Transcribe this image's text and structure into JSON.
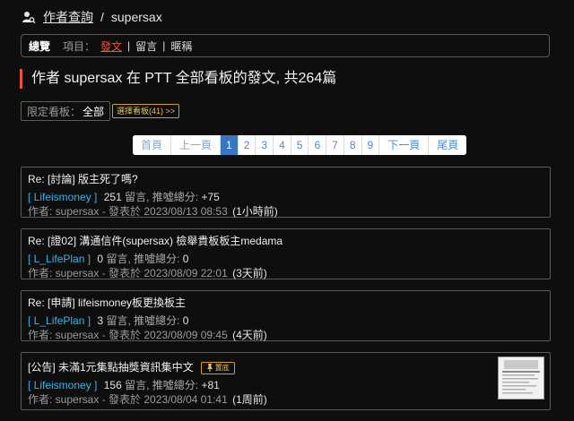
{
  "breadcrumb": {
    "link": "作者查詢",
    "separator": "/",
    "author": "supersax"
  },
  "nav": {
    "overview": "總覽",
    "items_label": "項目：",
    "tabs": [
      {
        "label": "發文",
        "active": true
      },
      {
        "label": "留言",
        "active": false
      },
      {
        "label": "暱稱",
        "active": false
      }
    ],
    "separator": "|"
  },
  "heading": "作者 supersax 在 PTT 全部看板的發文, 共264篇",
  "filter": {
    "label": "限定看板：",
    "value": "全部",
    "select_button": "選擇看板(41) >>"
  },
  "pagination": {
    "first": "首頁",
    "prev": "上一頁",
    "pages": [
      "1",
      "2",
      "3",
      "4",
      "5",
      "6",
      "7",
      "8",
      "9"
    ],
    "current": "1",
    "next": "下一頁",
    "last": "尾頁"
  },
  "posts": [
    {
      "title": "Re: [討論] 版主死了嗎?",
      "board": "[ Lifeismoney ]",
      "comments": "251",
      "comments_label": "留言, 推噓總分:",
      "score": "+75",
      "author_line": "作者: supersax - 發表於 2023/08/13 08:53",
      "ago": "(1小時前)"
    },
    {
      "title": "Re: [證02] 溝通信件(supersax) 檢舉貴板板主medama",
      "board": "[ L_LifePlan ]",
      "comments": "0",
      "comments_label": "留言, 推噓總分:",
      "score": "0",
      "author_line": "作者: supersax - 發表於 2023/08/09 22:01",
      "ago": "(3天前)"
    },
    {
      "title": "Re: [申請] lifeismoney板更換板主",
      "board": "[ L_LifePlan ]",
      "comments": "3",
      "comments_label": "留言, 推噓總分:",
      "score": "0",
      "author_line": "作者: supersax - 發表於 2023/08/09 09:45",
      "ago": "(4天前)"
    },
    {
      "title": "[公告] 未滿1元集點抽獎資訊集中文",
      "badge": "置底",
      "board": "[ Lifeismoney ]",
      "comments": "156",
      "comments_label": "留言, 推噓總分:",
      "score": "+81",
      "author_line": "作者: supersax - 發表於 2023/08/04 01:41",
      "ago": "(1周前)"
    }
  ],
  "colors": {
    "accent": "#e8553a",
    "board": "#3bb3e6",
    "badge": "#d4a017",
    "page_active": "#3a77c2"
  },
  "icons": {
    "breadcrumb": "user-search-icon",
    "badge": "pin-icon"
  }
}
